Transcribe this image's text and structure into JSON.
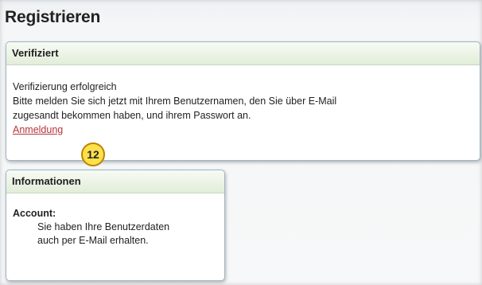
{
  "page": {
    "title": "Registrieren"
  },
  "verified_panel": {
    "heading": "Verifiziert",
    "status_line": "Verifizierung erfolgreich",
    "message_line1": "Bitte melden Sie sich jetzt mit Ihrem Benutzernamen, den Sie über E-Mail",
    "message_line2": "zugesandt bekommen haben, und ihrem Passwort an.",
    "login_link": "Anmeldung"
  },
  "info_panel": {
    "heading": "Informationen",
    "account_label": "Account:",
    "account_line1": "Sie haben Ihre Benutzerdaten",
    "account_line2": "auch per E-Mail erhalten."
  },
  "callout": {
    "number": "12",
    "color": "#ffe04a"
  },
  "colors": {
    "link": "#b6333a",
    "panel_border": "#9fb6c6",
    "panel_header": "#e2edd9"
  }
}
